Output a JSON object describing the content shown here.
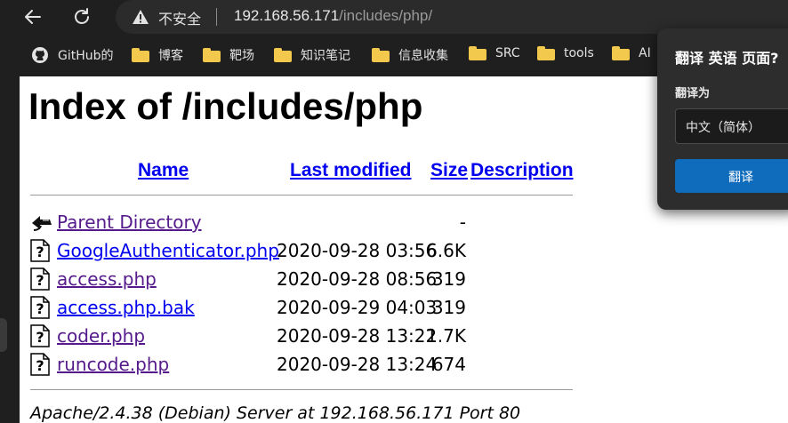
{
  "browser": {
    "security_label": "不安全",
    "url_host": "192.168.56.171",
    "url_path": "/includes/php/"
  },
  "bookmarks": [
    {
      "label": "GitHub的",
      "icon": "github-icon"
    },
    {
      "label": "博客",
      "icon": "folder-icon"
    },
    {
      "label": "靶场",
      "icon": "folder-icon"
    },
    {
      "label": "知识笔记",
      "icon": "folder-icon"
    },
    {
      "label": "信息收集",
      "icon": "folder-icon"
    },
    {
      "label": "SRC",
      "icon": "folder-icon"
    },
    {
      "label": "tools",
      "icon": "folder-icon"
    },
    {
      "label": "AI",
      "icon": "folder-icon"
    }
  ],
  "listing": {
    "title": "Index of /includes/php",
    "headers": {
      "name": "Name",
      "modified": "Last modified",
      "size": "Size",
      "description": "Description"
    },
    "rows": [
      {
        "name": "Parent Directory",
        "modified": "",
        "size": "-",
        "icon": "back-arrow-icon"
      },
      {
        "name": "GoogleAuthenticator.php",
        "modified": "2020-09-28 03:56",
        "size": "6.6K",
        "icon": "unknown-file-icon"
      },
      {
        "name": "access.php",
        "modified": "2020-09-28 08:56",
        "size": "319",
        "icon": "unknown-file-icon"
      },
      {
        "name": "access.php.bak",
        "modified": "2020-09-29 04:03",
        "size": "319",
        "icon": "unknown-file-icon"
      },
      {
        "name": "coder.php",
        "modified": "2020-09-28 13:22",
        "size": "1.7K",
        "icon": "unknown-file-icon"
      },
      {
        "name": "runcode.php",
        "modified": "2020-09-28 13:24",
        "size": "674",
        "icon": "unknown-file-icon"
      }
    ],
    "footer": "Apache/2.4.38 (Debian) Server at 192.168.56.171 Port 80"
  },
  "translate_popup": {
    "title": "翻译 英语 页面?",
    "target_label": "翻译为",
    "target_value": "中文（简体）",
    "button_label": "翻译"
  }
}
